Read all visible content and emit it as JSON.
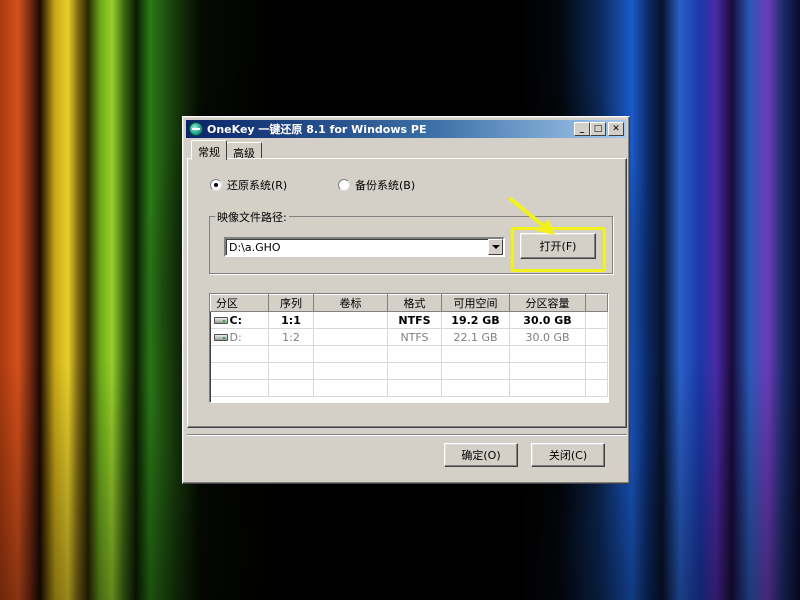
{
  "window": {
    "title": "OneKey 一键还原 8.1 for Windows PE",
    "minimize_glyph": "_",
    "maximize_glyph": "□",
    "close_glyph": "✕"
  },
  "tabs": [
    {
      "label": "常规",
      "active": true
    },
    {
      "label": "高级",
      "active": false
    }
  ],
  "mode": {
    "restore_label": "还原系统(R)",
    "backup_label": "备份系统(B)",
    "selected": "restore"
  },
  "image_path": {
    "group_label": "映像文件路径:",
    "value": "D:\\a.GHO",
    "open_button": "打开(F)"
  },
  "partitions": {
    "columns": [
      "分区",
      "序列",
      "卷标",
      "格式",
      "可用空间",
      "分区容量"
    ],
    "rows": [
      {
        "drive": "C:",
        "seq": "1:1",
        "label": "",
        "format": "NTFS",
        "free": "19.2 GB",
        "capacity": "30.0 GB",
        "selected": true
      },
      {
        "drive": "D:",
        "seq": "1:2",
        "label": "",
        "format": "NTFS",
        "free": "22.1 GB",
        "capacity": "30.0 GB",
        "selected": false
      }
    ]
  },
  "footer": {
    "ok_label": "确定(O)",
    "close_label": "关闭(C)"
  },
  "annotation": {
    "highlight_color": "#f2f21a"
  }
}
